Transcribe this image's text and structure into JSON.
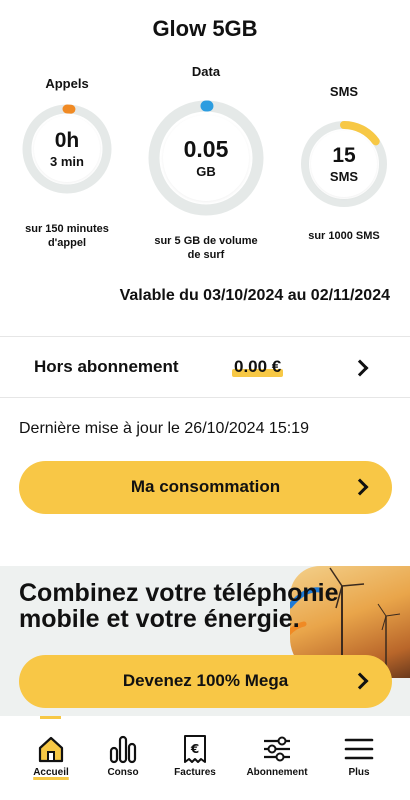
{
  "plan": {
    "title": "Glow 5GB"
  },
  "gauges": {
    "calls": {
      "label": "Appels",
      "value": "0h",
      "unit": "3 min",
      "caption1": "sur 150 minutes",
      "caption2": "d'appel",
      "used_fraction": 0.02,
      "color": "#f08a24"
    },
    "data": {
      "label": "Data",
      "value": "0.05",
      "unit": "GB",
      "caption1": "sur 5 GB de volume",
      "caption2": "de surf",
      "used_fraction": 0.01,
      "color": "#2d9de0"
    },
    "sms": {
      "label": "SMS",
      "value": "15",
      "unit": "SMS",
      "caption1": "sur 1000 SMS",
      "used_fraction": 0.15,
      "color": "#f7c845"
    }
  },
  "validity": "Valable du 03/10/2024 au 02/11/2024",
  "out_of_plan": {
    "label": "Hors abonnement",
    "amount": "0.00 €"
  },
  "last_update": "Dernière mise à jour le 26/10/2024 15:19",
  "consumption_button": "Ma consommation",
  "promo": {
    "headline_line1": "Combinez votre téléphonie",
    "headline_line2": "mobile et votre énergie.",
    "button": "Devenez 100% Mega"
  },
  "tabs": [
    {
      "label": "Accueil",
      "icon": "home-icon",
      "active": true
    },
    {
      "label": "Conso",
      "icon": "bar-chart-icon"
    },
    {
      "label": "Factures",
      "icon": "invoice-euro-icon"
    },
    {
      "label": "Abonnement",
      "icon": "sliders-icon"
    },
    {
      "label": "Plus",
      "icon": "menu-icon"
    }
  ],
  "colors": {
    "accent": "#f7c845",
    "ring_track": "#e5e9e8"
  }
}
